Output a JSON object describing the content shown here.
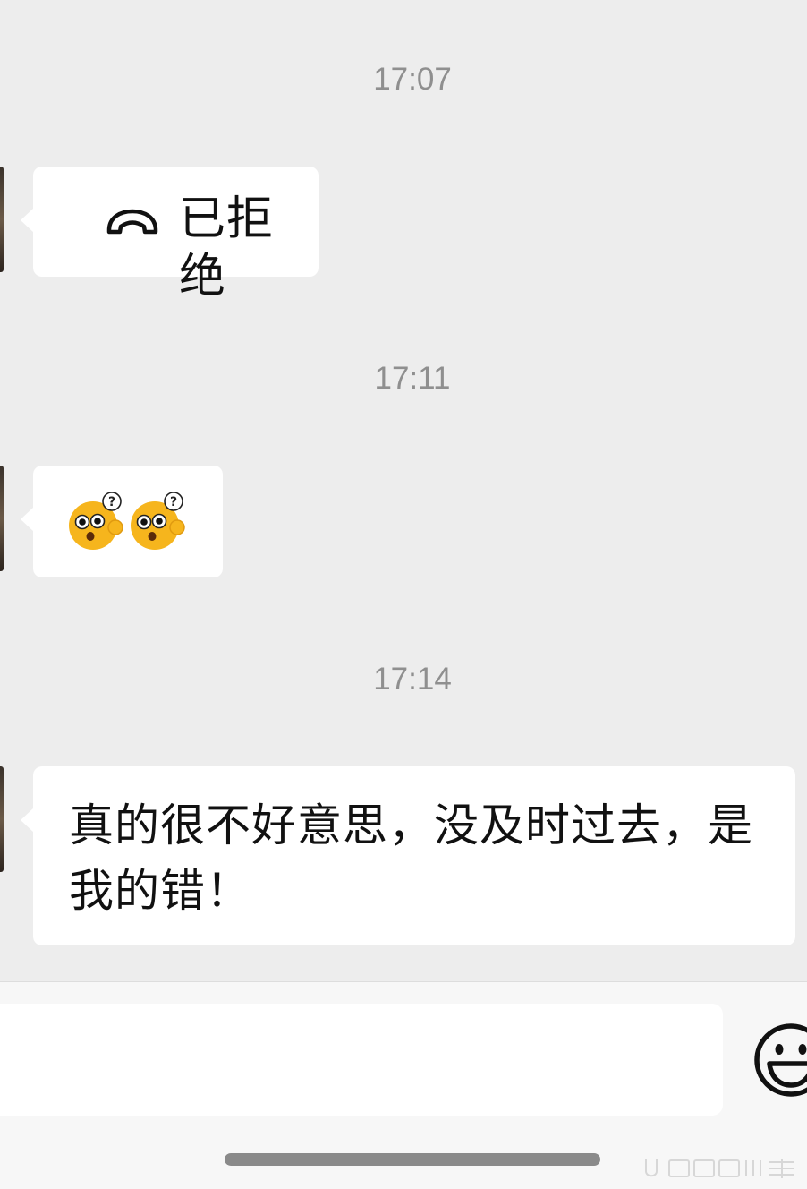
{
  "messages": [
    {
      "time": "17:07",
      "type": "call",
      "text": "已拒绝",
      "icon": "phone-hangup-icon"
    },
    {
      "time": "17:11",
      "type": "emoji",
      "emojis": [
        "puzzled-face-icon",
        "puzzled-face-icon"
      ]
    },
    {
      "time": "17:14",
      "type": "text",
      "text": "真的很不好意思，没及时过去，是我的错！"
    }
  ],
  "input_bar": {
    "value": "",
    "emoji_button_icon": "smiley-icon"
  },
  "colors": {
    "background": "#ededed",
    "bubble": "#ffffff",
    "timestamp": "#8f8f8f",
    "emoji_yellow": "#f6b51d"
  }
}
